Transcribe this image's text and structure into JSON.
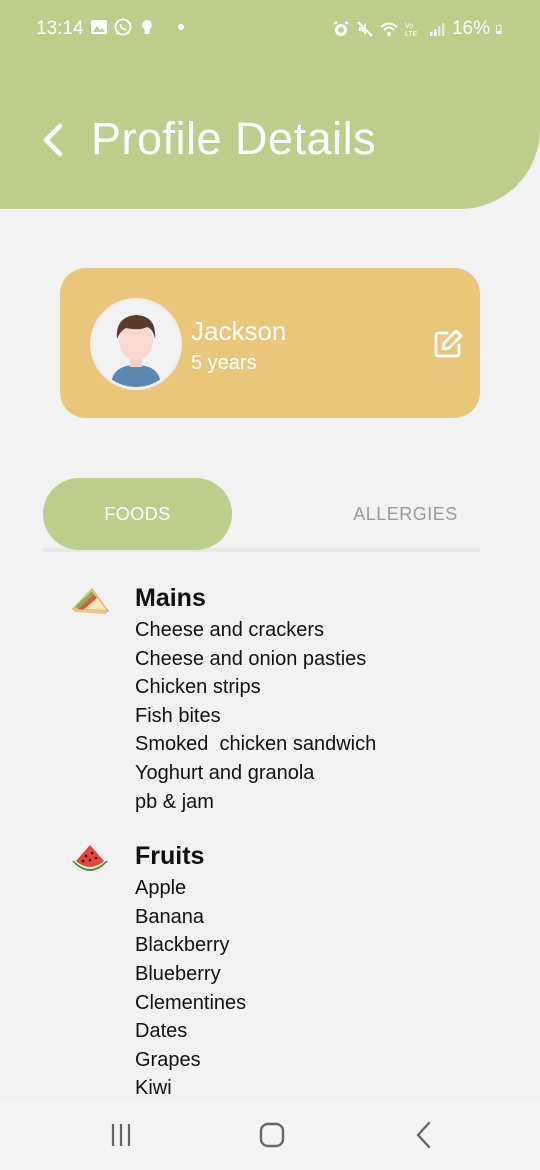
{
  "status_bar": {
    "time": "13:14",
    "battery": "16%",
    "left_icons": [
      "gallery-icon",
      "whatsapp-icon",
      "bulb-icon",
      "dot-icon"
    ],
    "right_icons": [
      "alarm-icon",
      "mute-icon",
      "wifi-icon",
      "lte-icon",
      "signal-icon",
      "battery-icon"
    ]
  },
  "header": {
    "title": "Profile Details",
    "back_icon": "chevron-left-icon",
    "color": "#bccd8c"
  },
  "profile": {
    "name": "Jackson",
    "age": "5 years",
    "card_color": "#e9c67a",
    "edit_icon": "edit-icon"
  },
  "tabs": [
    {
      "label": "FOODS",
      "active": true
    },
    {
      "label": "ALLERGIES",
      "active": false
    }
  ],
  "food_categories": [
    {
      "title": "Mains",
      "icon": "sandwich-icon",
      "items": [
        "Cheese and crackers",
        "Cheese and onion pasties",
        "Chicken strips",
        "Fish bites",
        "Smoked  chicken sandwich",
        "Yoghurt and granola",
        "pb & jam"
      ]
    },
    {
      "title": "Fruits",
      "icon": "watermelon-icon",
      "items": [
        "Apple",
        "Banana",
        "Blackberry",
        "Blueberry",
        "Clementines",
        "Dates",
        "Grapes",
        "Kiwi"
      ]
    }
  ],
  "nav_bar": {
    "buttons": [
      "recent-apps-icon",
      "home-icon",
      "back-icon"
    ]
  }
}
